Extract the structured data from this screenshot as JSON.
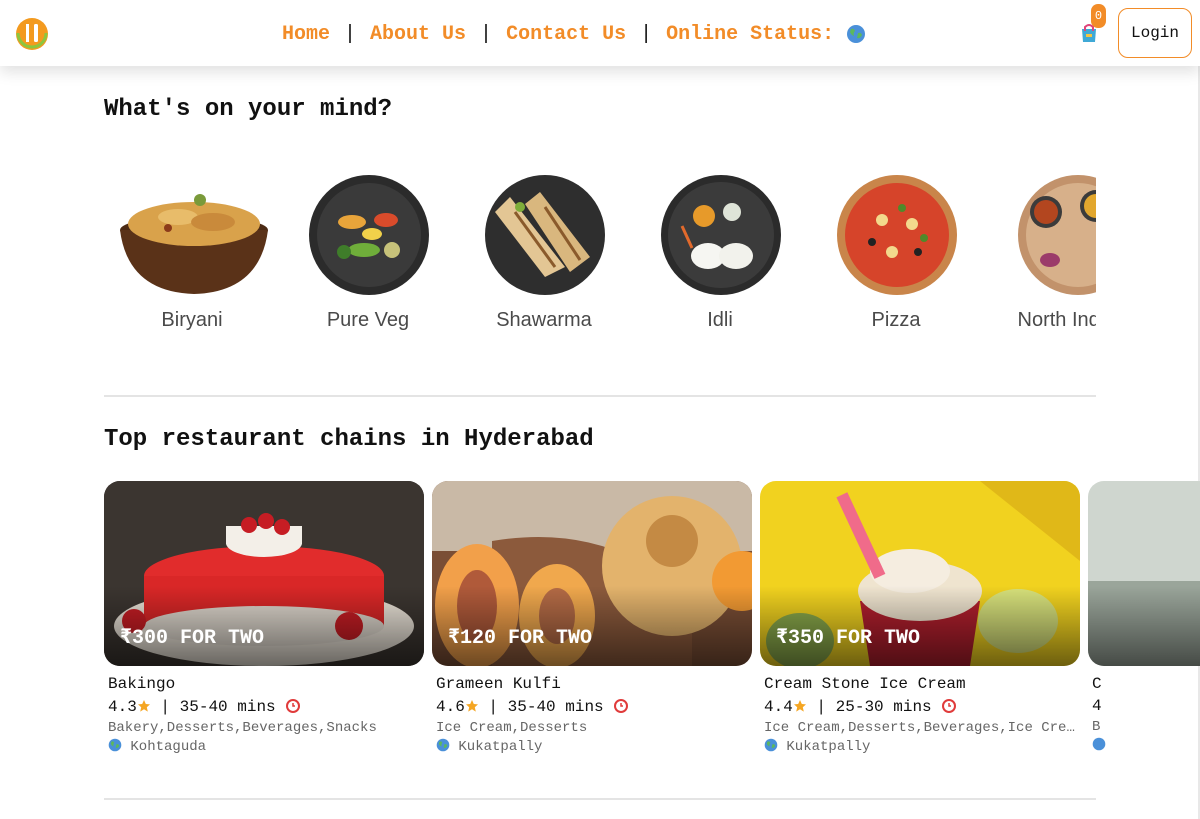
{
  "header": {
    "nav": [
      "Home",
      "About Us",
      "Contact Us",
      "Online Status:"
    ],
    "online_icon": "globe-icon",
    "cart_count": "0",
    "login_label": "Login",
    "accent": "#f28c28"
  },
  "sections": {
    "mind_title": "What's on your mind?",
    "chains_title": "Top restaurant chains in Hyderabad"
  },
  "cuisines": [
    "Biryani",
    "Pure Veg",
    "Shawarma",
    "Idli",
    "Pizza",
    "North Indian"
  ],
  "restaurants": [
    {
      "name": "Bakingo",
      "price": "₹300 FOR TWO",
      "rating": "4.3",
      "time": "35-40 mins",
      "cuisines": "Bakery,Desserts,Beverages,Snacks",
      "area": "Kohtaguda"
    },
    {
      "name": "Grameen Kulfi",
      "price": "₹120 FOR TWO",
      "rating": "4.6",
      "time": "35-40 mins",
      "cuisines": "Ice Cream,Desserts",
      "area": "Kukatpally"
    },
    {
      "name": "Cream Stone Ice Cream",
      "price": "₹350 FOR TWO",
      "rating": "4.4",
      "time": "25-30 mins",
      "cuisines": "Ice Cream,Desserts,Beverages,Ice Cream Cakes",
      "area": "Kukatpally"
    },
    {
      "name": "",
      "price": "",
      "rating": "4",
      "time": "",
      "cuisines": "",
      "area": ""
    }
  ]
}
